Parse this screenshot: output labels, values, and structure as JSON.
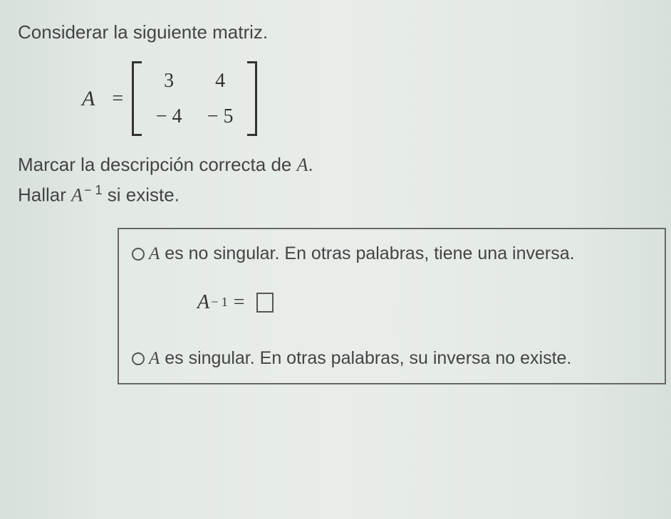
{
  "question": {
    "intro": "Considerar la siguiente matriz.",
    "matrix_label": "A",
    "equals": "=",
    "matrix": {
      "r1c1": "3",
      "r1c2": "4",
      "r2c1": "− 4",
      "r2c2": "− 5"
    },
    "instruction1_pre": "Marcar la descripción correcta de ",
    "instruction1_var": "A",
    "instruction1_post": ".",
    "instruction2_pre": "Hallar ",
    "instruction2_var": "A",
    "instruction2_exp": "− 1",
    "instruction2_post": " si existe."
  },
  "options": {
    "opt1_var": "A",
    "opt1_text": " es no singular. En otras palabras, tiene una inversa.",
    "inverse_var": "A",
    "inverse_exp": "− 1",
    "inverse_eq": "=",
    "opt2_var": "A",
    "opt2_text": " es singular. En otras palabras, su inversa no existe."
  }
}
